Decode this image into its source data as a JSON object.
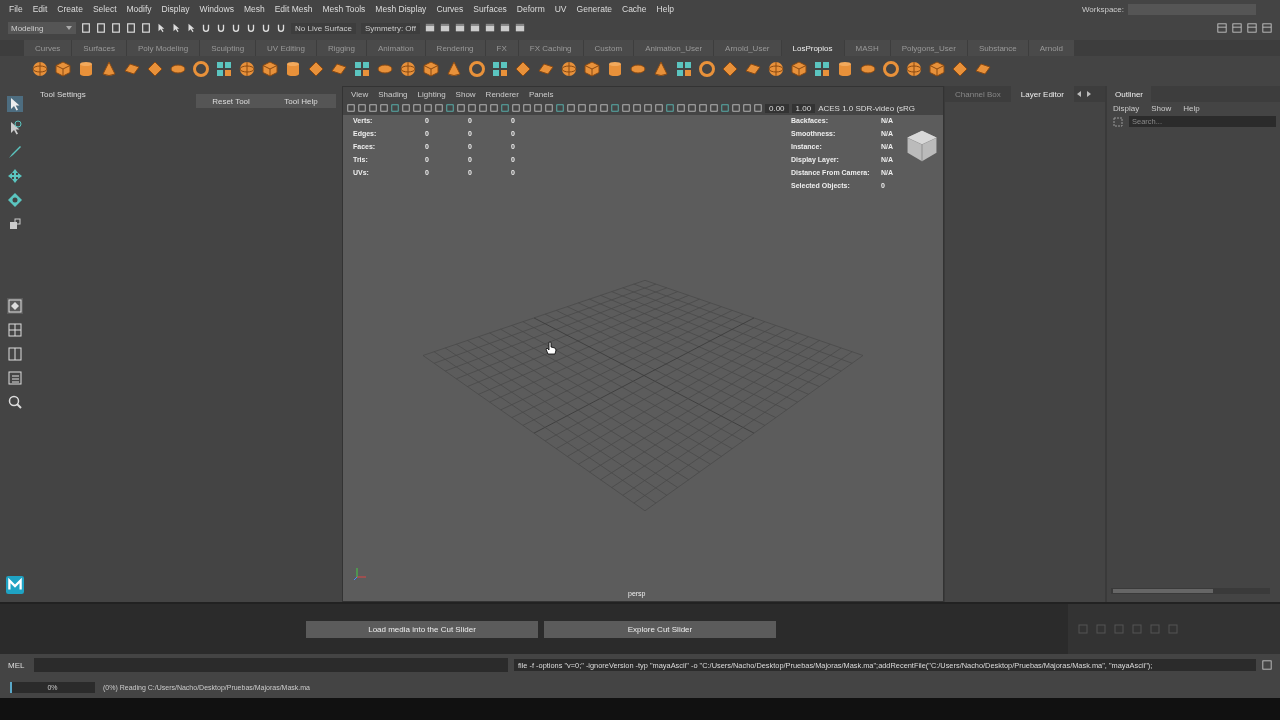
{
  "menu_bar": [
    "File",
    "Edit",
    "Create",
    "Select",
    "Modify",
    "Display",
    "Windows",
    "Mesh",
    "Edit Mesh",
    "Mesh Tools",
    "Mesh Display",
    "Curves",
    "Surfaces",
    "Deform",
    "UV",
    "Generate",
    "Cache",
    "Help"
  ],
  "status_line": {
    "mode": "Modeling",
    "live_surface": "No Live Surface",
    "symmetry": "Symmetry: Off"
  },
  "workspace": {
    "label": "Workspace:"
  },
  "shelf_tabs": [
    {
      "label": "Curves",
      "selected": false
    },
    {
      "label": "Surfaces",
      "selected": false
    },
    {
      "label": "Poly Modeling",
      "selected": false
    },
    {
      "label": "Sculpting",
      "selected": false
    },
    {
      "label": "UV Editing",
      "selected": false
    },
    {
      "label": "Rigging",
      "selected": false
    },
    {
      "label": "Animation",
      "selected": false
    },
    {
      "label": "Rendering",
      "selected": false
    },
    {
      "label": "FX",
      "selected": false
    },
    {
      "label": "FX Caching",
      "selected": false
    },
    {
      "label": "Custom",
      "selected": false
    },
    {
      "label": "Animation_User",
      "selected": false
    },
    {
      "label": "Arnold_User",
      "selected": false
    },
    {
      "label": "LosPropios",
      "selected": true
    },
    {
      "label": "MASH",
      "selected": false
    },
    {
      "label": "Polygons_User",
      "selected": false
    },
    {
      "label": "Substance",
      "selected": false
    },
    {
      "label": "Arnold",
      "selected": false
    }
  ],
  "tool_settings": {
    "title": "Tool Settings",
    "buttons": [
      "Reset Tool",
      "Tool Help"
    ]
  },
  "viewport": {
    "menu": [
      "View",
      "Shading",
      "Lighting",
      "Show",
      "Renderer",
      "Panels"
    ],
    "exposure": "0.00",
    "gamma": "1.00",
    "color_space": "ACES 1.0 SDR-video (sRG",
    "hud_left": [
      {
        "label": "Verts:",
        "values": [
          "0",
          "0",
          "0"
        ]
      },
      {
        "label": "Edges:",
        "values": [
          "0",
          "0",
          "0"
        ]
      },
      {
        "label": "Faces:",
        "values": [
          "0",
          "0",
          "0"
        ]
      },
      {
        "label": "Tris:",
        "values": [
          "0",
          "0",
          "0"
        ]
      },
      {
        "label": "UVs:",
        "values": [
          "0",
          "0",
          "0"
        ]
      }
    ],
    "hud_right": [
      {
        "label": "Backfaces:",
        "value": "N/A"
      },
      {
        "label": "Smoothness:",
        "value": "N/A"
      },
      {
        "label": "Instance:",
        "value": "N/A"
      },
      {
        "label": "Display Layer:",
        "value": "N/A"
      },
      {
        "label": "Distance From Camera:",
        "value": "N/A"
      },
      {
        "label": "Selected Objects:",
        "value": "0"
      }
    ],
    "camera": "persp"
  },
  "panel_tabs": [
    {
      "label": "Channel Box",
      "selected": false
    },
    {
      "label": "Layer Editor",
      "selected": true
    }
  ],
  "outliner": {
    "title": "Outliner",
    "menu": [
      "Display",
      "Show",
      "Help"
    ],
    "placeholder": "Search..."
  },
  "cut_slider": {
    "buttons": [
      "Load media into the Cut Slider",
      "Explore Cut Slider"
    ]
  },
  "command_line": {
    "language": "MEL",
    "output": "file -f -options \"v=0;\"  -ignoreVersion  -typ \"mayaAscii\" -o \"C:/Users/Nacho/Desktop/Pruebas/Majoras/Mask.ma\";addRecentFile(\"C:/Users/Nacho/Desktop/Pruebas/Majoras/Mask.ma\", \"mayaAscii\");"
  },
  "help_line": {
    "progress": {
      "level": 0.02,
      "label": "0%"
    },
    "message": "(0%) Reading C:/Users/Nacho/Desktop/Pruebas/Majoras/Mask.ma"
  }
}
